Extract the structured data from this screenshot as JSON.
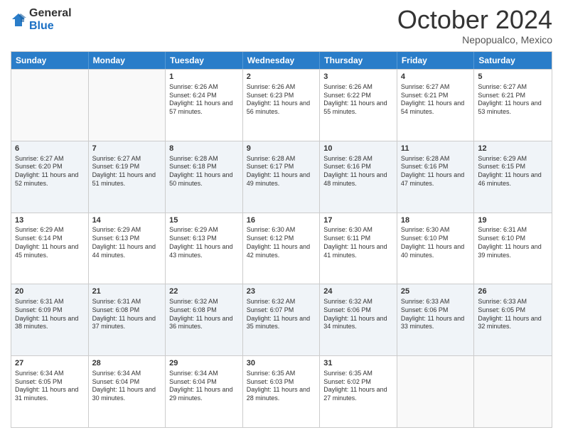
{
  "header": {
    "logo": {
      "general": "General",
      "blue": "Blue"
    },
    "title": "October 2024",
    "subtitle": "Nepopualco, Mexico"
  },
  "days": [
    "Sunday",
    "Monday",
    "Tuesday",
    "Wednesday",
    "Thursday",
    "Friday",
    "Saturday"
  ],
  "weeks": [
    [
      {
        "day": "",
        "sunrise": "",
        "sunset": "",
        "daylight": ""
      },
      {
        "day": "",
        "sunrise": "",
        "sunset": "",
        "daylight": ""
      },
      {
        "day": "1",
        "sunrise": "Sunrise: 6:26 AM",
        "sunset": "Sunset: 6:24 PM",
        "daylight": "Daylight: 11 hours and 57 minutes."
      },
      {
        "day": "2",
        "sunrise": "Sunrise: 6:26 AM",
        "sunset": "Sunset: 6:23 PM",
        "daylight": "Daylight: 11 hours and 56 minutes."
      },
      {
        "day": "3",
        "sunrise": "Sunrise: 6:26 AM",
        "sunset": "Sunset: 6:22 PM",
        "daylight": "Daylight: 11 hours and 55 minutes."
      },
      {
        "day": "4",
        "sunrise": "Sunrise: 6:27 AM",
        "sunset": "Sunset: 6:21 PM",
        "daylight": "Daylight: 11 hours and 54 minutes."
      },
      {
        "day": "5",
        "sunrise": "Sunrise: 6:27 AM",
        "sunset": "Sunset: 6:21 PM",
        "daylight": "Daylight: 11 hours and 53 minutes."
      }
    ],
    [
      {
        "day": "6",
        "sunrise": "Sunrise: 6:27 AM",
        "sunset": "Sunset: 6:20 PM",
        "daylight": "Daylight: 11 hours and 52 minutes."
      },
      {
        "day": "7",
        "sunrise": "Sunrise: 6:27 AM",
        "sunset": "Sunset: 6:19 PM",
        "daylight": "Daylight: 11 hours and 51 minutes."
      },
      {
        "day": "8",
        "sunrise": "Sunrise: 6:28 AM",
        "sunset": "Sunset: 6:18 PM",
        "daylight": "Daylight: 11 hours and 50 minutes."
      },
      {
        "day": "9",
        "sunrise": "Sunrise: 6:28 AM",
        "sunset": "Sunset: 6:17 PM",
        "daylight": "Daylight: 11 hours and 49 minutes."
      },
      {
        "day": "10",
        "sunrise": "Sunrise: 6:28 AM",
        "sunset": "Sunset: 6:16 PM",
        "daylight": "Daylight: 11 hours and 48 minutes."
      },
      {
        "day": "11",
        "sunrise": "Sunrise: 6:28 AM",
        "sunset": "Sunset: 6:16 PM",
        "daylight": "Daylight: 11 hours and 47 minutes."
      },
      {
        "day": "12",
        "sunrise": "Sunrise: 6:29 AM",
        "sunset": "Sunset: 6:15 PM",
        "daylight": "Daylight: 11 hours and 46 minutes."
      }
    ],
    [
      {
        "day": "13",
        "sunrise": "Sunrise: 6:29 AM",
        "sunset": "Sunset: 6:14 PM",
        "daylight": "Daylight: 11 hours and 45 minutes."
      },
      {
        "day": "14",
        "sunrise": "Sunrise: 6:29 AM",
        "sunset": "Sunset: 6:13 PM",
        "daylight": "Daylight: 11 hours and 44 minutes."
      },
      {
        "day": "15",
        "sunrise": "Sunrise: 6:29 AM",
        "sunset": "Sunset: 6:13 PM",
        "daylight": "Daylight: 11 hours and 43 minutes."
      },
      {
        "day": "16",
        "sunrise": "Sunrise: 6:30 AM",
        "sunset": "Sunset: 6:12 PM",
        "daylight": "Daylight: 11 hours and 42 minutes."
      },
      {
        "day": "17",
        "sunrise": "Sunrise: 6:30 AM",
        "sunset": "Sunset: 6:11 PM",
        "daylight": "Daylight: 11 hours and 41 minutes."
      },
      {
        "day": "18",
        "sunrise": "Sunrise: 6:30 AM",
        "sunset": "Sunset: 6:10 PM",
        "daylight": "Daylight: 11 hours and 40 minutes."
      },
      {
        "day": "19",
        "sunrise": "Sunrise: 6:31 AM",
        "sunset": "Sunset: 6:10 PM",
        "daylight": "Daylight: 11 hours and 39 minutes."
      }
    ],
    [
      {
        "day": "20",
        "sunrise": "Sunrise: 6:31 AM",
        "sunset": "Sunset: 6:09 PM",
        "daylight": "Daylight: 11 hours and 38 minutes."
      },
      {
        "day": "21",
        "sunrise": "Sunrise: 6:31 AM",
        "sunset": "Sunset: 6:08 PM",
        "daylight": "Daylight: 11 hours and 37 minutes."
      },
      {
        "day": "22",
        "sunrise": "Sunrise: 6:32 AM",
        "sunset": "Sunset: 6:08 PM",
        "daylight": "Daylight: 11 hours and 36 minutes."
      },
      {
        "day": "23",
        "sunrise": "Sunrise: 6:32 AM",
        "sunset": "Sunset: 6:07 PM",
        "daylight": "Daylight: 11 hours and 35 minutes."
      },
      {
        "day": "24",
        "sunrise": "Sunrise: 6:32 AM",
        "sunset": "Sunset: 6:06 PM",
        "daylight": "Daylight: 11 hours and 34 minutes."
      },
      {
        "day": "25",
        "sunrise": "Sunrise: 6:33 AM",
        "sunset": "Sunset: 6:06 PM",
        "daylight": "Daylight: 11 hours and 33 minutes."
      },
      {
        "day": "26",
        "sunrise": "Sunrise: 6:33 AM",
        "sunset": "Sunset: 6:05 PM",
        "daylight": "Daylight: 11 hours and 32 minutes."
      }
    ],
    [
      {
        "day": "27",
        "sunrise": "Sunrise: 6:34 AM",
        "sunset": "Sunset: 6:05 PM",
        "daylight": "Daylight: 11 hours and 31 minutes."
      },
      {
        "day": "28",
        "sunrise": "Sunrise: 6:34 AM",
        "sunset": "Sunset: 6:04 PM",
        "daylight": "Daylight: 11 hours and 30 minutes."
      },
      {
        "day": "29",
        "sunrise": "Sunrise: 6:34 AM",
        "sunset": "Sunset: 6:04 PM",
        "daylight": "Daylight: 11 hours and 29 minutes."
      },
      {
        "day": "30",
        "sunrise": "Sunrise: 6:35 AM",
        "sunset": "Sunset: 6:03 PM",
        "daylight": "Daylight: 11 hours and 28 minutes."
      },
      {
        "day": "31",
        "sunrise": "Sunrise: 6:35 AM",
        "sunset": "Sunset: 6:02 PM",
        "daylight": "Daylight: 11 hours and 27 minutes."
      },
      {
        "day": "",
        "sunrise": "",
        "sunset": "",
        "daylight": ""
      },
      {
        "day": "",
        "sunrise": "",
        "sunset": "",
        "daylight": ""
      }
    ]
  ]
}
